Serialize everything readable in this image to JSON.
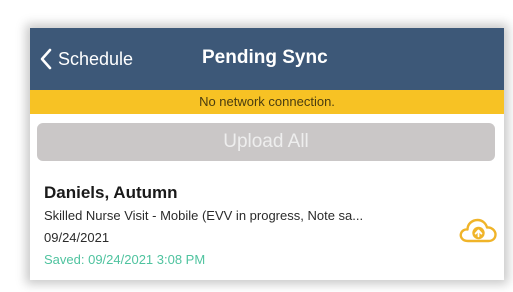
{
  "navbar": {
    "back_label": "Schedule",
    "title": "Pending Sync",
    "background_color": "#3d5878"
  },
  "banner": {
    "text": "No network connection.",
    "background_color": "#f7c224"
  },
  "upload_all": {
    "label": "Upload All",
    "state": "disabled"
  },
  "pending_items": [
    {
      "name": "Daniels, Autumn",
      "description": "Skilled Nurse Visit - Mobile (EVV in progress, Note sa...",
      "date": "09/24/2021",
      "saved": "Saved: 09/24/2021 3:08 PM",
      "action_icon": "cloud-upload-icon",
      "icon_color": "#f0b429",
      "saved_color": "#4fc39f"
    }
  ]
}
